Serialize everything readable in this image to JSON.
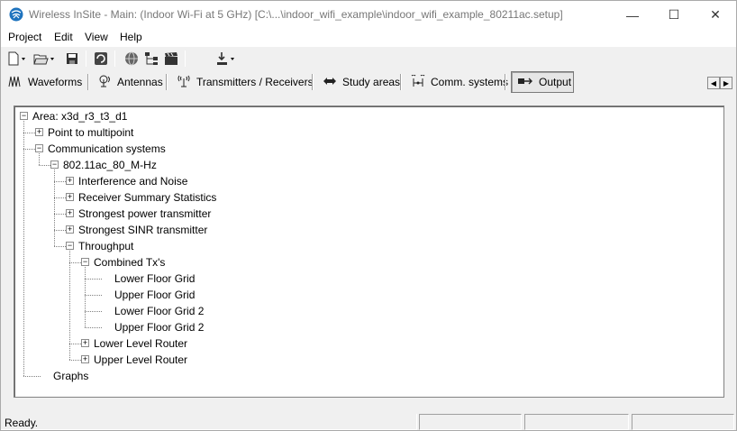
{
  "window": {
    "title": "Wireless InSite - Main: (Indoor Wi-Fi at 5 GHz) [C:\\...\\indoor_wifi_example\\indoor_wifi_example_80211ac.setup]",
    "controls": {
      "minimize": "—",
      "maximize": "☐",
      "close": "✕"
    }
  },
  "menubar": {
    "items": [
      "Project",
      "Edit",
      "View",
      "Help"
    ]
  },
  "toolbar": {
    "icons": [
      "new-file-icon",
      "open-folder-icon",
      "save-icon",
      "refresh-icon",
      "globe-icon",
      "tree-structure-icon",
      "clapperboard-icon",
      "download-icon"
    ]
  },
  "tabs": [
    {
      "label": "Waveforms",
      "icon": "waveform-icon"
    },
    {
      "label": "Antennas",
      "icon": "antenna-icon"
    },
    {
      "label": "Transmitters / Receivers",
      "icon": "transmitter-icon"
    },
    {
      "label": "Study areas",
      "icon": "study-area-icon"
    },
    {
      "label": "Comm. systems",
      "icon": "comm-system-icon"
    },
    {
      "label": "Output",
      "icon": "output-icon",
      "active": true
    }
  ],
  "tree": [
    {
      "label": "Area: x3d_r3_t3_d1",
      "depth": 0,
      "state": "expanded"
    },
    {
      "label": "Point to multipoint",
      "depth": 1,
      "state": "collapsed"
    },
    {
      "label": "Communication systems",
      "depth": 1,
      "state": "expanded"
    },
    {
      "label": "802.11ac_80_M-Hz",
      "depth": 2,
      "state": "expanded"
    },
    {
      "label": "Interference and Noise",
      "depth": 3,
      "state": "collapsed"
    },
    {
      "label": "Receiver Summary Statistics",
      "depth": 3,
      "state": "collapsed"
    },
    {
      "label": "Strongest power transmitter",
      "depth": 3,
      "state": "collapsed"
    },
    {
      "label": "Strongest SINR transmitter",
      "depth": 3,
      "state": "collapsed"
    },
    {
      "label": "Throughput",
      "depth": 3,
      "state": "expanded"
    },
    {
      "label": "Combined Tx's",
      "depth": 4,
      "state": "expanded"
    },
    {
      "label": "Lower Floor Grid",
      "depth": 5,
      "state": "leaf"
    },
    {
      "label": "Upper Floor Grid",
      "depth": 5,
      "state": "leaf"
    },
    {
      "label": "Lower Floor Grid 2",
      "depth": 5,
      "state": "leaf"
    },
    {
      "label": "Upper Floor Grid 2",
      "depth": 5,
      "state": "leaf"
    },
    {
      "label": "Lower Level Router",
      "depth": 4,
      "state": "collapsed"
    },
    {
      "label": "Upper Level Router",
      "depth": 4,
      "state": "collapsed"
    },
    {
      "label": "Graphs",
      "depth": 1,
      "state": "leaf"
    }
  ],
  "statusbar": {
    "text": "Ready."
  },
  "colors": {
    "titlebar": "#ffffff",
    "chrome": "#f0f0f0",
    "tree_bg": "#ffffff",
    "app_icon": "#1e73be"
  }
}
